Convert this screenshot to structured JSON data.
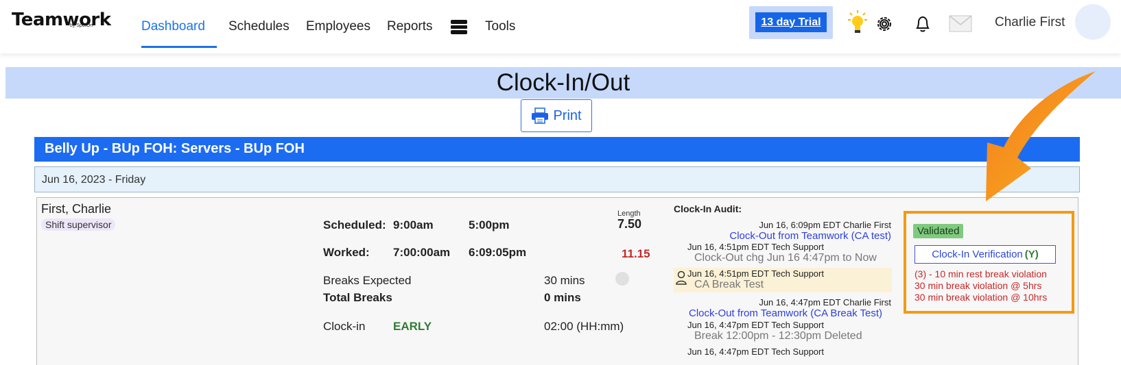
{
  "header": {
    "brand": "Teamwork",
    "brand_sub": "by SpotOn",
    "nav": [
      {
        "label": "Dashboard",
        "active": true
      },
      {
        "label": "Schedules"
      },
      {
        "label": "Employees"
      },
      {
        "label": "Reports"
      },
      {
        "label": "Tools"
      }
    ],
    "trial": "13 day Trial",
    "user": "Charlie First",
    "icons": [
      "report-stack-icon",
      "lightbulb-icon",
      "gear-icon",
      "bell-icon",
      "mail-icon"
    ]
  },
  "page": {
    "title": "Clock-In/Out",
    "print": "Print"
  },
  "location": "Belly Up - BUp FOH: Servers - BUp FOH",
  "date": "Jun 16, 2023 - Friday",
  "shift": {
    "name": "First, Charlie",
    "role": "Shift supervisor",
    "scheduled_label": "Scheduled:",
    "scheduled_start": "9:00am",
    "scheduled_end": "5:00pm",
    "length_caption": "Length",
    "length": "7.50",
    "worked_label": "Worked:",
    "worked_start": "7:00:00am",
    "worked_end": "6:09:05pm",
    "worked_length": "11.15",
    "breaks_expected_label": "Breaks Expected",
    "breaks_expected": "30 mins",
    "total_breaks_label": "Total Breaks",
    "total_breaks": "0 mins",
    "clockin_label": "Clock-in",
    "clockin_status": "EARLY",
    "clockin_diff": "02:00 (HH:mm)"
  },
  "audit": {
    "title": "Clock-In Audit:",
    "entries": [
      {
        "meta": "Jun 16, 6:09pm EDT Charlie First",
        "text": "Clock-Out from Teamwork (CA test)"
      },
      {
        "meta": "Jun 16, 4:51pm EDT Tech Support",
        "text": "Clock-Out chg Jun 16 4:47pm to Now"
      },
      {
        "meta": "Jun 16, 4:51pm EDT Tech Support",
        "text": "CA Break Test"
      },
      {
        "meta": "Jun 16, 4:47pm EDT Charlie First",
        "text": "Clock-Out from Teamwork (CA Break Test)"
      },
      {
        "meta": "Jun 16, 4:47pm EDT Tech Support",
        "text": "Break 12:00pm - 12:30pm Deleted"
      },
      {
        "meta": "Jun 16, 4:47pm EDT Tech Support",
        "text": ""
      }
    ]
  },
  "validation": {
    "status": "Validated",
    "verify_label": "Clock-In Verification",
    "verify_value": "(Y)",
    "violations": [
      "(3) - 10 min rest break violation",
      "30 min break violation @ 5hrs",
      "30 min break violation @ 10hrs"
    ]
  },
  "colors": {
    "primary": "#1c6cf2",
    "highlight_border": "#f39a14",
    "violation": "#c62828",
    "validated": "#7fca7f"
  }
}
